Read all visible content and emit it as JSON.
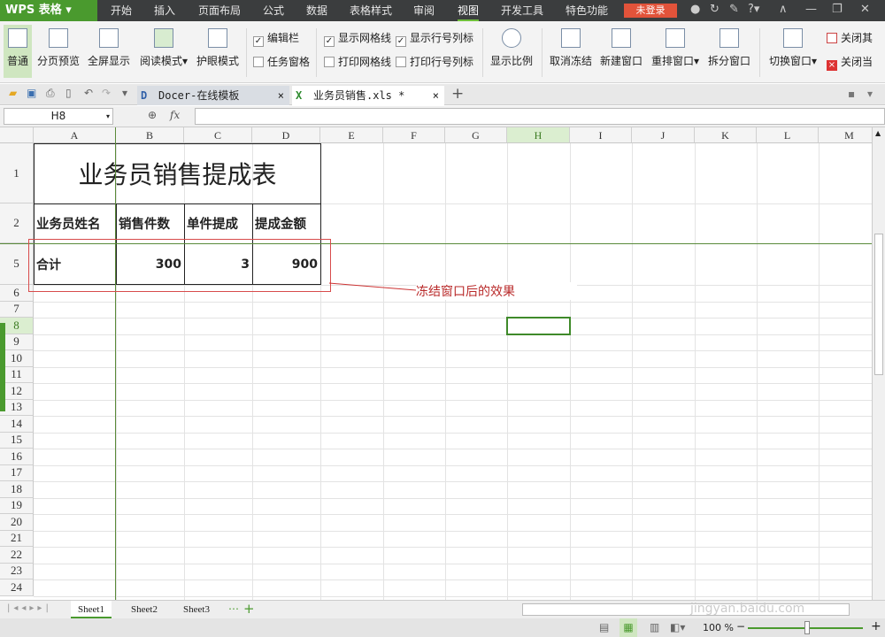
{
  "app": {
    "logo": "WPS 表格",
    "menu_tabs": [
      "开始",
      "插入",
      "页面布局",
      "公式",
      "数据",
      "表格样式",
      "审阅",
      "视图",
      "开发工具",
      "特色功能"
    ],
    "active_tab": "视图",
    "login": "未登录"
  },
  "ribbon": {
    "buttons": [
      "普通",
      "分页预览",
      "全屏显示",
      "阅读模式",
      "护眼模式"
    ],
    "checks": [
      {
        "label": "编辑栏",
        "checked": true
      },
      {
        "label": "任务窗格",
        "checked": false
      },
      {
        "label": "显示网格线",
        "checked": true
      },
      {
        "label": "打印网格线",
        "checked": false
      },
      {
        "label": "显示行号列标",
        "checked": true
      },
      {
        "label": "打印行号列标",
        "checked": false
      }
    ],
    "buttons2": [
      "显示比例",
      "取消冻结",
      "新建窗口",
      "重排窗口",
      "拆分窗口",
      "切换窗口"
    ],
    "close_other": "关闭其",
    "close_current": "关闭当"
  },
  "doc_tabs": [
    "Docer-在线模板",
    "业务员销售.xls *"
  ],
  "formula": {
    "name_box": "H8",
    "fx": "fx",
    "value": ""
  },
  "columns": [
    "A",
    "B",
    "C",
    "D",
    "E",
    "F",
    "G",
    "H",
    "I",
    "J",
    "K",
    "L",
    "M"
  ],
  "rows": [
    "1",
    "2",
    "5",
    "6",
    "7",
    "8",
    "9",
    "10",
    "11",
    "12",
    "13",
    "14",
    "15",
    "16",
    "17",
    "18",
    "19",
    "20",
    "21",
    "22",
    "23",
    "24"
  ],
  "cells": {
    "title": "业务员销售提成表",
    "headers": [
      "业务员姓名",
      "销售件数",
      "单件提成",
      "提成金额"
    ],
    "total": [
      "合计",
      "300",
      "3",
      "900"
    ]
  },
  "annotation": "冻结窗口后的效果",
  "sheets": [
    "Sheet1",
    "Sheet2",
    "Sheet3"
  ],
  "status": {
    "zoom": "100 %"
  },
  "watermark": "jingyan.baidu.com"
}
